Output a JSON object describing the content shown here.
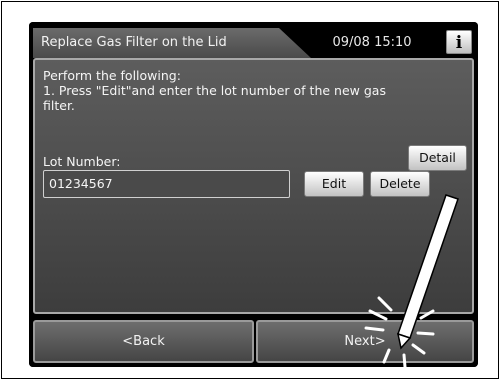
{
  "header": {
    "title": "Replace Gas Filter on the Lid",
    "datetime": "09/08 15:10",
    "info_label": "i"
  },
  "instructions": {
    "line1": "Perform the following:",
    "line2": "1. Press \"Edit\"and enter the lot number of the new gas",
    "line3": "filter."
  },
  "lot": {
    "label": "Lot Number:",
    "value": "01234567"
  },
  "buttons": {
    "detail": "Detail",
    "edit": "Edit",
    "delete": "Delete",
    "back": "<Back",
    "next": "Next>"
  },
  "icons": {
    "stylus": "stylus-pointer-icon",
    "tap": "tap-indicator-icon"
  }
}
